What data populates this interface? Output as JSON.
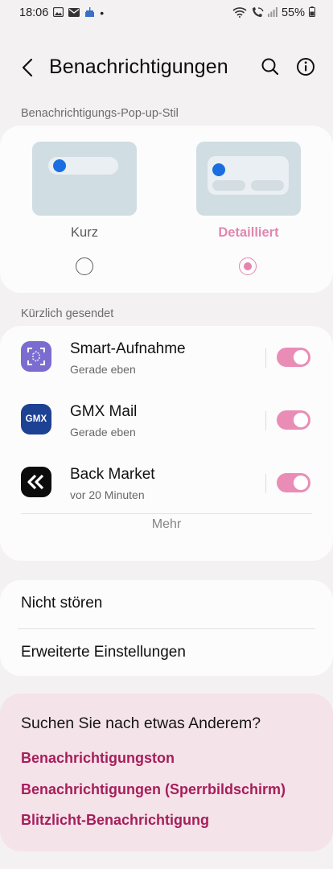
{
  "status_bar": {
    "time": "18:06",
    "dot": "•",
    "battery": "55%",
    "left_icons": [
      "image-icon",
      "mail-icon",
      "cake-icon"
    ],
    "right_icons": [
      "wifi-icon",
      "wifi-call-icon",
      "signal-icon",
      "battery-icon"
    ]
  },
  "header": {
    "title": "Benachrichtigungen",
    "back_icon": "back-arrow-icon",
    "search_icon": "search-icon",
    "info_icon": "info-icon"
  },
  "popup_style": {
    "section_label": "Benachrichtigungs-Pop-up-Stil",
    "options": [
      {
        "label": "Kurz",
        "selected": false
      },
      {
        "label": "Detailliert",
        "selected": true
      }
    ],
    "accent_color": "#e186b0",
    "preview_color": "#d0dde3",
    "preview_dot_color": "#1a6ee0"
  },
  "recent": {
    "section_label": "Kürzlich gesendet",
    "apps": [
      {
        "name": "Smart-Aufnahme",
        "time": "Gerade eben",
        "icon": "smart-capture-icon",
        "enabled": true
      },
      {
        "name": "GMX Mail",
        "time": "Gerade eben",
        "icon": "gmx-icon",
        "icon_text": "GMX",
        "enabled": true
      },
      {
        "name": "Back Market",
        "time": "vor 20 Minuten",
        "icon": "back-market-icon",
        "enabled": true
      }
    ],
    "more_label": "Mehr",
    "toggle_color": "#ea8db6"
  },
  "settings": {
    "items": [
      {
        "label": "Nicht stören"
      },
      {
        "label": "Erweiterte Einstellungen"
      }
    ]
  },
  "suggestions": {
    "title": "Suchen Sie nach etwas Anderem?",
    "links": [
      {
        "label": "Benachrichtigungston"
      },
      {
        "label": "Benachrichtigungen (Sperrbildschirm)"
      },
      {
        "label": "Blitzlicht-Benachrichtigung"
      }
    ],
    "link_color": "#a61e5b",
    "background": "#f4e3e9"
  }
}
